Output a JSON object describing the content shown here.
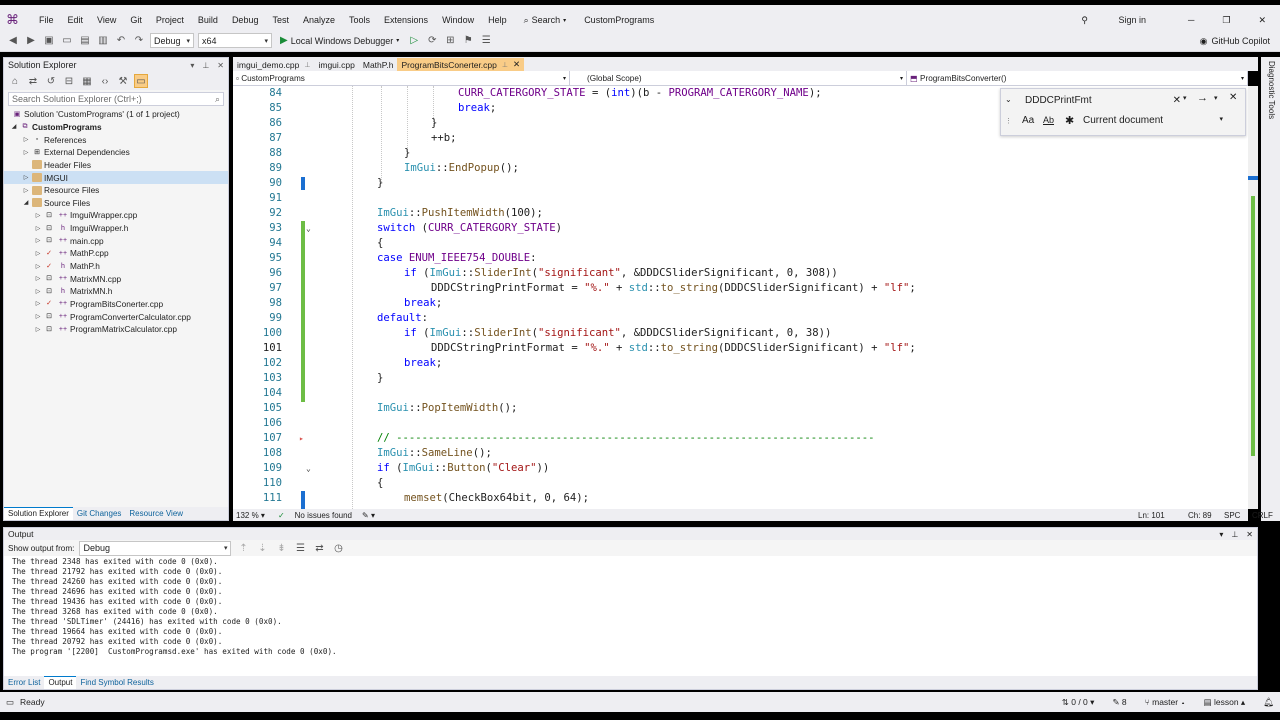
{
  "menu": {
    "items": [
      "File",
      "Edit",
      "View",
      "Git",
      "Project",
      "Build",
      "Debug",
      "Test",
      "Analyze",
      "Tools",
      "Extensions",
      "Window",
      "Help"
    ],
    "search_label": "Search",
    "solution_name": "CustomPrograms",
    "sign_in": "Sign in"
  },
  "toolbar": {
    "config": "Debug",
    "platform": "x64",
    "debugger": "Local Windows Debugger",
    "copilot": "GitHub Copilot"
  },
  "solution_explorer": {
    "title": "Solution Explorer",
    "search_placeholder": "Search Solution Explorer (Ctrl+;)",
    "items": [
      {
        "label": "Solution 'CustomPrograms' (1 of 1 project)"
      },
      {
        "label": "CustomPrograms"
      },
      {
        "label": "References"
      },
      {
        "label": "External Dependencies"
      },
      {
        "label": "Header Files"
      },
      {
        "label": "IMGUI"
      },
      {
        "label": "Resource Files"
      },
      {
        "label": "Source Files"
      },
      {
        "label": "ImguiWrapper.cpp"
      },
      {
        "label": "ImguiWrapper.h"
      },
      {
        "label": "main.cpp"
      },
      {
        "label": "MathP.cpp"
      },
      {
        "label": "MathP.h"
      },
      {
        "label": "MatrixMN.cpp"
      },
      {
        "label": "MatrixMN.h"
      },
      {
        "label": "ProgramBitsConerter.cpp"
      },
      {
        "label": "ProgramConverterCalculator.cpp"
      },
      {
        "label": "ProgramMatrixCalculator.cpp"
      }
    ],
    "bottom_tabs": [
      "Solution Explorer",
      "Git Changes",
      "Resource View"
    ]
  },
  "editor": {
    "tabs": [
      "imgui_demo.cpp",
      "imgui.cpp",
      "MathP.h",
      "ProgramBitsConerter.cpp"
    ],
    "nav_project": "CustomPrograms",
    "nav_scope": "(Global Scope)",
    "nav_func": "ProgramBitsConverter()",
    "line_numbers": [
      "84",
      "85",
      "86",
      "87",
      "88",
      "89",
      "90",
      "91",
      "92",
      "93",
      "94",
      "95",
      "96",
      "97",
      "98",
      "99",
      "100",
      "101",
      "102",
      "103",
      "104",
      "105",
      "106",
      "107",
      "108",
      "109",
      "110",
      "111"
    ],
    "zoom": "132 %",
    "issues": "No issues found",
    "ln": "Ln: 101",
    "ch": "Ch: 89",
    "spc": "SPC",
    "crlf": "CRLF"
  },
  "find": {
    "query": "DDDCPrintFmt",
    "scope": "Current document",
    "aa": "Aa",
    "ab": "Ab"
  },
  "output": {
    "title": "Output",
    "show_from_label": "Show output from:",
    "source": "Debug",
    "lines": [
      "The thread 2348 has exited with code 0 (0x0).",
      "The thread 21792 has exited with code 0 (0x0).",
      "The thread 24260 has exited with code 0 (0x0).",
      "The thread 24696 has exited with code 0 (0x0).",
      "The thread 19436 has exited with code 0 (0x0).",
      "The thread 3268 has exited with code 0 (0x0).",
      "The thread 'SDLTimer' (24416) has exited with code 0 (0x0).",
      "The thread 19664 has exited with code 0 (0x0).",
      "The thread 20792 has exited with code 0 (0x0).",
      "The program '[2200]  CustomProgramsd.exe' has exited with code 0 (0x0)."
    ],
    "bottom_tabs": [
      "Error List",
      "Output",
      "Find Symbol Results"
    ]
  },
  "status": {
    "ready": "Ready",
    "errors": "0 / 0",
    "pencil": "8",
    "branch": "master",
    "repo": "lesson"
  },
  "side": {
    "diagnostic": "Diagnostic Tools"
  }
}
